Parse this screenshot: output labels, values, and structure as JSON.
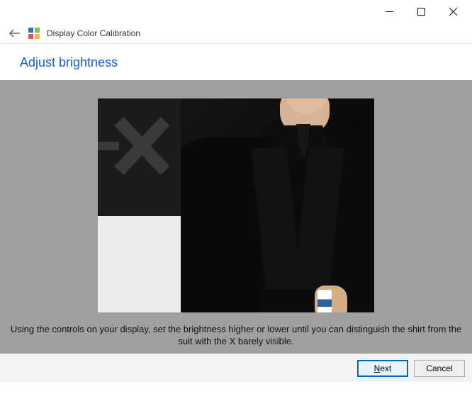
{
  "window": {
    "app_title": "Display Color Calibration"
  },
  "page": {
    "title": "Adjust brightness",
    "instruction": "Using the controls on your display, set the brightness higher or lower until you can distinguish the shirt from the suit with the X barely visible."
  },
  "footer": {
    "next_label_prefix": "N",
    "next_label_rest": "ext",
    "cancel_label": "Cancel"
  }
}
